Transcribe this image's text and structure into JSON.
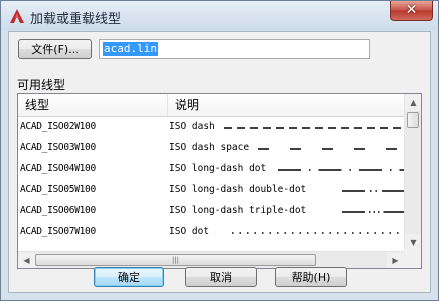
{
  "window": {
    "title": "加载或重载线型",
    "close_glyph": "✕"
  },
  "file": {
    "button_label": "文件(F)...",
    "value": "acad.lin"
  },
  "group_label": "可用线型",
  "table": {
    "columns": [
      "线型",
      "说明"
    ],
    "rows": [
      {
        "name": "ACAD_ISO02W100",
        "desc": "ISO dash",
        "pattern": "dash"
      },
      {
        "name": "ACAD_ISO03W100",
        "desc": "ISO dash space",
        "pattern": "dash-space"
      },
      {
        "name": "ACAD_ISO04W100",
        "desc": "ISO long-dash dot",
        "pattern": "long-dash-dot"
      },
      {
        "name": "ACAD_ISO05W100",
        "desc": "ISO long-dash double-dot",
        "pattern": "long-dash-double-dot"
      },
      {
        "name": "ACAD_ISO06W100",
        "desc": "ISO long-dash triple-dot",
        "pattern": "long-dash-triple-dot"
      },
      {
        "name": "ACAD_ISO07W100",
        "desc": "ISO dot",
        "pattern": "dot"
      }
    ]
  },
  "buttons": {
    "ok": "确定",
    "cancel": "取消",
    "help": "帮助(H)"
  },
  "scroll": {
    "up": "▲",
    "down": "▼",
    "left": "◀",
    "right": "▶",
    "grip": "|||"
  },
  "colors": {
    "selection": "#3399ff",
    "close": "#c75044",
    "accent": "#3c7fb1"
  },
  "icons": {
    "app": "autocad-logo-icon"
  }
}
